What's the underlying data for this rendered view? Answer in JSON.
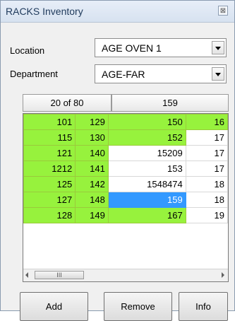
{
  "window": {
    "title": "RACKS Inventory",
    "close_glyph": "⊠"
  },
  "location": {
    "label": "Location",
    "value": "AGE OVEN 1"
  },
  "department": {
    "label": "Department",
    "value": "AGE-FAR"
  },
  "grid_header": {
    "count": "20 of 80",
    "current": "159"
  },
  "grid": {
    "rows": [
      [
        "101",
        "129",
        "150",
        "16"
      ],
      [
        "115",
        "130",
        "152",
        "17"
      ],
      [
        "121",
        "140",
        "15209",
        "17"
      ],
      [
        "1212",
        "141",
        "153",
        "17"
      ],
      [
        "125",
        "142",
        "1548474",
        "18"
      ],
      [
        "127",
        "148",
        "159",
        "18"
      ],
      [
        "128",
        "149",
        "167",
        "19"
      ]
    ],
    "selected": "159",
    "cell_color": "#97f23d",
    "selection_color": "#3399ff"
  },
  "scrollbar": {
    "thumb_grip": "III"
  },
  "buttons": {
    "add": "Add",
    "remove": "Remove",
    "info": "Info"
  }
}
